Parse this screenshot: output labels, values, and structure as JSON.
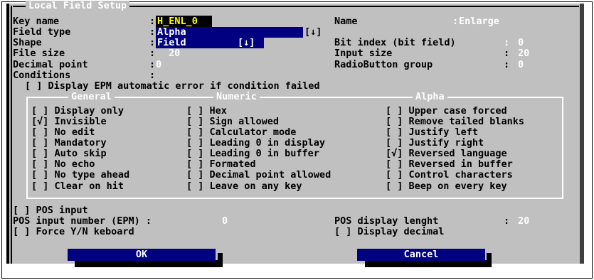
{
  "dialog": {
    "title": "Local Field Setup"
  },
  "fields": {
    "key_name": {
      "label": "Key name",
      "colon": ":",
      "value": "H_ENL_0"
    },
    "name": {
      "label": "Name",
      "colon": ":",
      "value": "Enlarge"
    },
    "field_type": {
      "label": "Field type",
      "colon": ":",
      "value": "Alpha",
      "arrow": "[↓]"
    },
    "shape": {
      "label": "Shape",
      "colon": ":",
      "value": "Field",
      "arrow": "[↓]"
    },
    "bit_index": {
      "label": "Bit index (bit field)",
      "colon": ":",
      "value": "0"
    },
    "file_size": {
      "label": "File size",
      "colon": ":",
      "value": "20"
    },
    "input_size": {
      "label": "Input size",
      "colon": ":",
      "value": "20"
    },
    "decimal_point": {
      "label": "Decimal point",
      "colon": ":",
      "value": "0"
    },
    "radio_group": {
      "label": "RadioButton group",
      "colon": ":",
      "value": "0"
    },
    "conditions": {
      "label": "Conditions",
      "colon": ":"
    }
  },
  "display_epm": {
    "label": "[ ] Display EPM automatic error if condition failed"
  },
  "groups": {
    "general": {
      "label": "General",
      "items": [
        "[ ] Display only",
        "[√] Invisible",
        "[ ] No edit",
        "[ ] Mandatory",
        "[ ] Auto skip",
        "[ ] No echo",
        "[ ] No type ahead",
        "[ ] Clear on hit"
      ]
    },
    "numeric": {
      "label": "Numeric",
      "items": [
        "[ ] Hex",
        "[ ] Sign allowed",
        "[ ] Calculator mode",
        "[ ] Leading 0 in display",
        "[ ] Leading 0 in buffer",
        "[ ] Formated",
        "[ ] Decimal point allowed",
        "[ ] Leave on any key"
      ]
    },
    "alpha": {
      "label": "Alpha",
      "items": [
        "[ ] Upper case forced",
        "[ ] Remove tailed blanks",
        "[ ] Justify left",
        "[ ] Justify right",
        "[√] Reversed language",
        "[ ] Reversed in buffer",
        "[ ] Control characters",
        "[ ] Beep on every key"
      ]
    }
  },
  "pos": {
    "pos_input": "[ ] POS input",
    "input_number_label": "POS input number (EPM) :",
    "input_number_value": "0",
    "display_length_label": "POS display lenght",
    "display_length_colon": ":",
    "display_length_value": "20",
    "force_yn": "[ ] Force Y/N keboard",
    "display_decimal": "[ ] Display decimal"
  },
  "buttons": {
    "ok": "OK",
    "cancel": "Cancel"
  },
  "colors": {
    "panel": "#c0c0c0",
    "highlight": "#000080",
    "text_dim": "#ffffff",
    "selected_text": "#ffff00"
  }
}
